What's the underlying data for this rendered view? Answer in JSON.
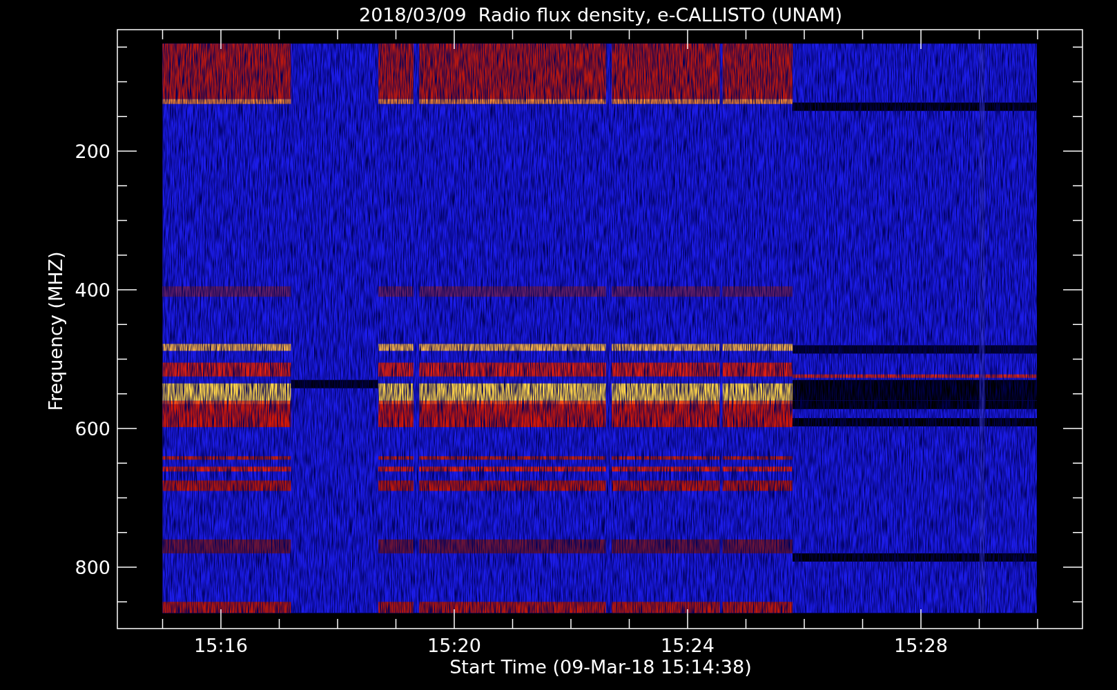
{
  "plot": {
    "title": "2018/03/09  Radio flux density, e-CALLISTO (UNAM)",
    "x_axis": {
      "label": "Start Time (09-Mar-18 15:14:38)",
      "ticks": [
        "15:16",
        "15:20",
        "15:24",
        "15:28"
      ]
    },
    "y_axis": {
      "label": "Frequency (MHZ)",
      "ticks": [
        "200",
        "400",
        "600",
        "800"
      ]
    }
  }
}
